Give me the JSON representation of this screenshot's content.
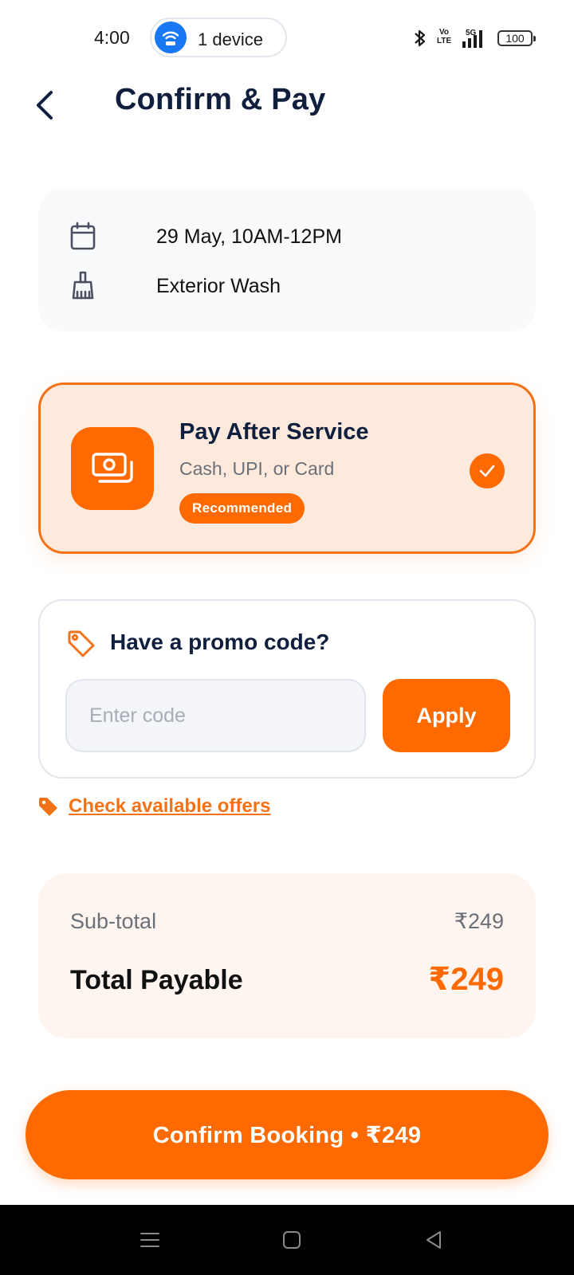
{
  "status_bar": {
    "time": "4:00",
    "hotspot_label": "1 device",
    "volte_label": "Vo LTE",
    "network_label": "5G",
    "battery": "100",
    "icons": [
      "wifi-hotspot-icon",
      "bluetooth-icon",
      "signal-icon",
      "battery-icon"
    ]
  },
  "header": {
    "title": "Confirm & Pay",
    "back_icon": "chevron-left-icon"
  },
  "booking": {
    "datetime": "29 May, 10AM-12PM",
    "service": "Exterior Wash",
    "icons": [
      "calendar-icon",
      "brush-icon"
    ]
  },
  "payment_option": {
    "title": "Pay After Service",
    "subtitle": "Cash, UPI, or Card",
    "badge": "Recommended",
    "selected": true,
    "icon": "cash-icon"
  },
  "promo": {
    "title": "Have a promo code?",
    "placeholder": "Enter code",
    "value": "",
    "apply_label": "Apply",
    "icon": "tag-outline-icon"
  },
  "offers": {
    "link_label": "Check available offers",
    "icon": "tag-filled-icon"
  },
  "totals": {
    "subtotal_label": "Sub-total",
    "subtotal_value": "₹249",
    "total_label": "Total Payable",
    "total_value": "₹249"
  },
  "confirm": {
    "label": "Confirm Booking • ₹249"
  },
  "nav_bar": {
    "items": [
      "menu-nav-icon",
      "home-nav-icon",
      "back-nav-icon"
    ]
  },
  "colors": {
    "accent": "#ff6a00",
    "accent_border": "#f47216",
    "title_navy": "#0f1f3d",
    "selected_card_bg": "#fdeadc",
    "totals_bg": "#fef5f0",
    "summary_bg": "#f9fafb",
    "hotspot_blue": "#1877f2"
  }
}
